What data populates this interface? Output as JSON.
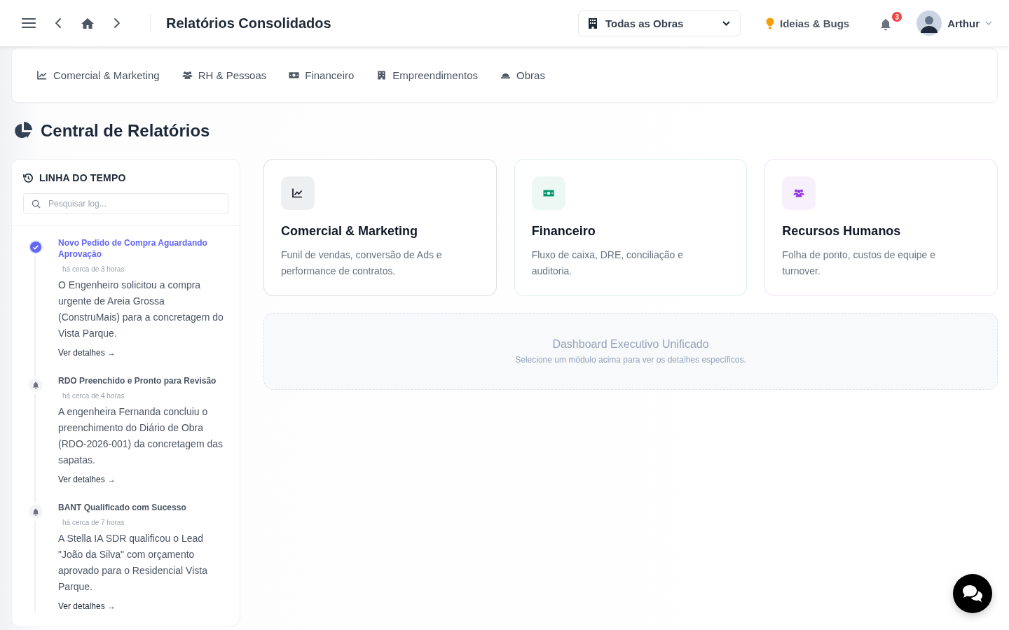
{
  "header": {
    "title": "Relatórios Consolidados",
    "project_select": {
      "value": "Todas as Obras"
    },
    "ideas_link": "Ideias & Bugs",
    "notifications": {
      "count": "3"
    },
    "user": {
      "name": "Arthur"
    }
  },
  "tabs": [
    {
      "label": "Comercial & Marketing"
    },
    {
      "label": "RH & Pessoas"
    },
    {
      "label": "Financeiro"
    },
    {
      "label": "Empreendimentos"
    },
    {
      "label": "Obras"
    }
  ],
  "page_title": "Central de Relatórios",
  "timeline": {
    "title": "LINHA DO TEMPO",
    "search": {
      "placeholder": "Pesquisar log..."
    },
    "items": [
      {
        "kind": "approval",
        "title": "Novo Pedido de Compra Aguardando Aprovação",
        "time": "há cerca de 3 horas",
        "text": "O Engenheiro solicitou a compra urgente de Areia Grossa (ConstruMais) para a concretagem do Vista Parque.",
        "link": "Ver detalhes →"
      },
      {
        "kind": "notice",
        "title": "RDO Preenchido e Pronto para Revisão",
        "time": "há cerca de 4 horas",
        "text": "A engenheira Fernanda concluiu o preenchimento do Diário de Obra (RDO-2026-001) da concretagem das sapatas.",
        "link": "Ver detalhes →"
      },
      {
        "kind": "notice",
        "title": "BANT Qualificado com Sucesso",
        "time": "há cerca de 7 horas",
        "text": "A Stella IA SDR qualificou o Lead \"João da Silva\" com orçamento aprovado para o Residencial Vista Parque.",
        "link": "Ver detalhes →"
      }
    ]
  },
  "modules": [
    {
      "color": "#111827",
      "title": "Comercial & Marketing",
      "description": "Funil de vendas, conversão de Ads e performance de contratos."
    },
    {
      "color": "#059669",
      "title": "Financeiro",
      "description": "Fluxo de caixa, DRE, conciliação e auditoria."
    },
    {
      "color": "#9333ea",
      "title": "Recursos Humanos",
      "description": "Folha de ponto, custos de equipe e turnover."
    }
  ],
  "dashboard": {
    "title": "Dashboard Executivo Unificado",
    "subtitle": "Selecione um módulo acima para ver os detalhes específicos."
  }
}
